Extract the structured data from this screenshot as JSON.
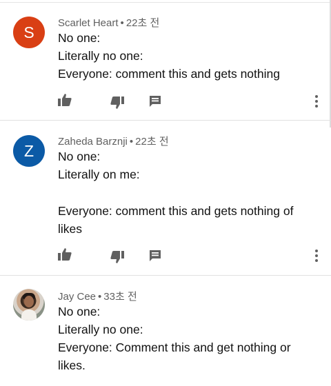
{
  "comments": [
    {
      "avatar_letter": "S",
      "avatar_color": "#d93f14",
      "author": "Scarlet Heart",
      "time": "22초 전",
      "lines": [
        "No one:",
        "Literally no one:",
        "Everyone: comment this and gets nothing"
      ]
    },
    {
      "avatar_letter": "Z",
      "avatar_color": "#0b5aa6",
      "author": "Zaheda Barznji",
      "time": "22초 전",
      "lines": [
        "No one:",
        "Literally on me:",
        "",
        "Everyone: comment this and gets nothing of",
        "likes"
      ]
    },
    {
      "avatar_letter": "",
      "avatar_color": "#8a9286",
      "author": "Jay Cee",
      "time": "33초 전",
      "lines": [
        "No one:",
        "Literally no one:",
        "Everyone: Comment this and get nothing or",
        "likes."
      ]
    }
  ],
  "meta_separator": "•",
  "icons": {
    "like": "thumb-up-icon",
    "dislike": "thumb-down-icon",
    "reply": "reply-comment-icon",
    "more": "more-vertical-icon"
  },
  "colors": {
    "text": "#111111",
    "meta": "#606060",
    "icon": "#606060",
    "divider": "#e0e0e0"
  }
}
